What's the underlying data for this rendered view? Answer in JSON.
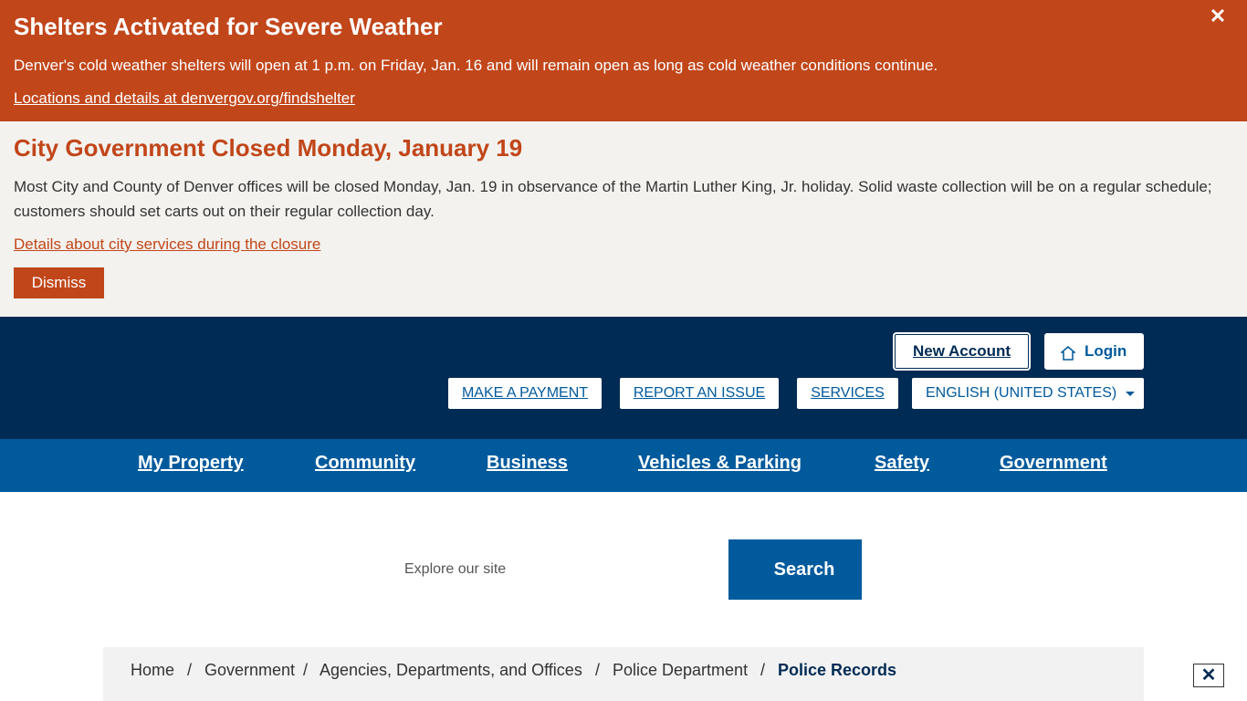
{
  "alert": {
    "title": "Shelters Activated for Severe Weather",
    "body": "Denver's cold weather shelters will open at 1 p.m. on Friday, Jan. 16 and will remain open as long as cold weather conditions continue.",
    "link": "Locations and details at denvergov.org/findshelter",
    "close_glyph": "✕",
    "background_color": "#c1461a"
  },
  "notice": {
    "title": "City Government Closed Monday, January 19",
    "body": "Most City and County of Denver offices will be closed Monday, Jan. 19 in observance of the Martin Luther King, Jr. holiday. Solid waste collection will be on a regular schedule; customers should set carts out on their regular collection day.",
    "link": "Details about city services during the closure",
    "dismiss_label": "Dismiss",
    "background_color": "#f3f2ee"
  },
  "header": {
    "background_color": "#002b54",
    "new_account_label": "New Account",
    "login_label": "Login",
    "login_icon": "home-icon",
    "utility_links": {
      "payment": "MAKE A PAYMENT",
      "report": "REPORT AN ISSUE",
      "services": "SERVICES",
      "language": "ENGLISH (UNITED STATES)"
    }
  },
  "nav": {
    "background_color": "#005a9c",
    "items": [
      "My Property",
      "Community",
      "Business",
      "Vehicles & Parking",
      "Safety",
      "Government"
    ]
  },
  "search": {
    "placeholder": "Explore our site",
    "button_label": "Search"
  },
  "breadcrumb": {
    "items": [
      "Home",
      "Government",
      "Agencies, Departments, and Offices",
      "Police Department",
      "Police Records"
    ],
    "separator": "/"
  },
  "float_close_glyph": "✕"
}
